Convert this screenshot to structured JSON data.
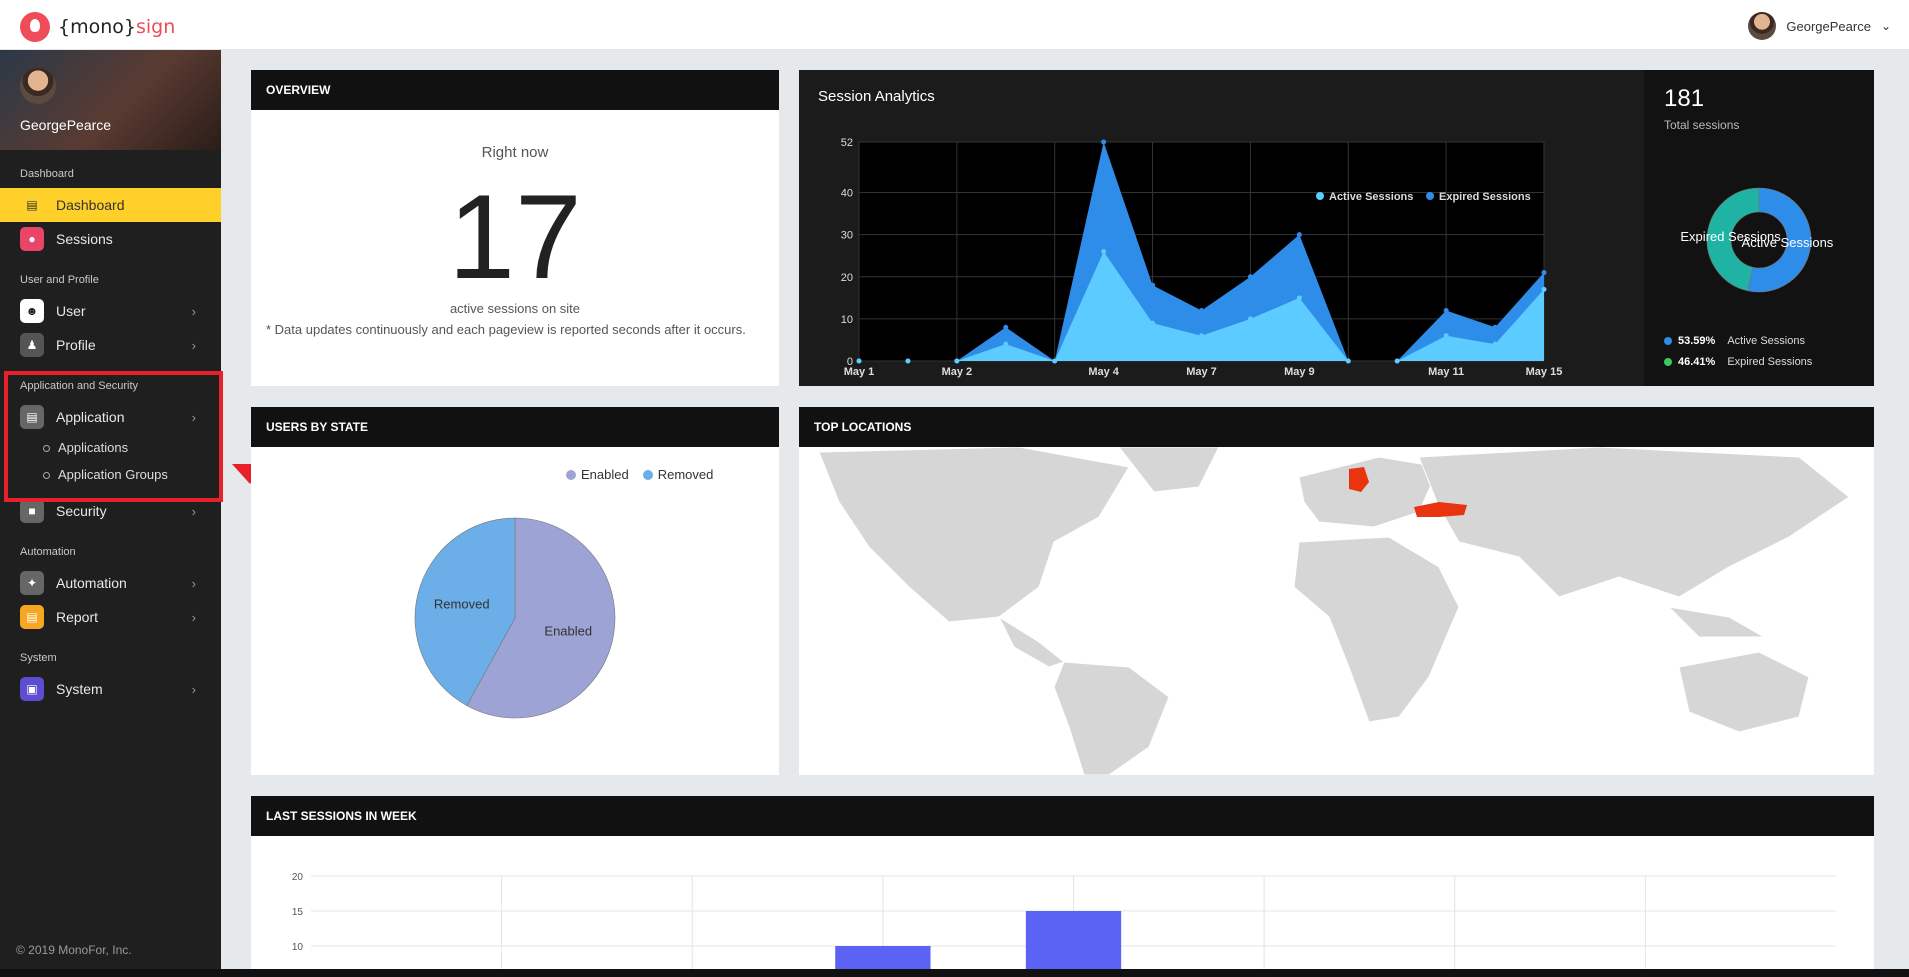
{
  "topbar": {
    "logo_prefix": "{mono}",
    "logo_brand": "sign",
    "username": "GeorgePearce"
  },
  "sidebar": {
    "username": "GeorgePearce",
    "sections": {
      "dashboard": "Dashboard",
      "user_profile": "User and Profile",
      "app_security": "Application and Security",
      "automation": "Automation",
      "system": "System"
    },
    "items": {
      "dashboard": "Dashboard",
      "sessions": "Sessions",
      "user": "User",
      "profile": "Profile",
      "application": "Application",
      "applications": "Applications",
      "application_groups": "Application Groups",
      "security": "Security",
      "automation": "Automation",
      "report": "Report",
      "system": "System"
    },
    "footer": "© 2019 MonoFor, Inc."
  },
  "overview": {
    "title": "OVERVIEW",
    "right_now": "Right now",
    "count": "17",
    "subtitle": "active sessions on site",
    "note": "* Data updates continuously and each pageview is reported seconds after it occurs."
  },
  "analytics": {
    "title": "Session Analytics",
    "total": "181",
    "total_label": "Total sessions",
    "active_pct": "53.59%",
    "active_label": "Active Sessions",
    "expired_pct": "46.41%",
    "expired_label": "Expired Sessions",
    "colors": {
      "active": "#2e8de8",
      "expired": "#1fb3a4",
      "active_area": "#5ccbff"
    }
  },
  "users_by_state": {
    "title": "USERS BY STATE",
    "legend_enabled": "Enabled",
    "legend_removed": "Removed",
    "label_enabled": "Enabled",
    "label_removed": "Removed",
    "colors": {
      "enabled": "#9ea3d6",
      "removed": "#6caee8"
    }
  },
  "top_locations": {
    "title": "TOP LOCATIONS",
    "highlighted": [
      "Germany",
      "Turkey"
    ]
  },
  "last_sessions": {
    "title": "LAST SESSIONS IN WEEK"
  },
  "chart_data": [
    {
      "type": "area",
      "title": "Session Analytics",
      "x": [
        "May 1",
        "",
        "May 2",
        "",
        "May 4",
        "",
        "May 7",
        "",
        "May 9",
        "",
        "May 11",
        "",
        "May 15"
      ],
      "tick_labels": [
        "May 1",
        "May 2",
        "May 4",
        "May 7",
        "May 9",
        "May 11",
        "May 15"
      ],
      "yticks": [
        0,
        10,
        20,
        30,
        40,
        52
      ],
      "ylim": [
        0,
        52
      ],
      "legend": [
        "Active Sessions",
        "Expired Sessions"
      ],
      "series": [
        {
          "name": "Expired Sessions",
          "values": [
            0,
            0,
            0,
            8,
            0,
            52,
            18,
            12,
            20,
            30,
            0,
            0,
            12,
            8,
            21
          ]
        },
        {
          "name": "Active Sessions",
          "values": [
            0,
            0,
            0,
            4,
            0,
            26,
            9,
            6,
            10,
            15,
            0,
            0,
            6,
            4,
            17
          ]
        }
      ],
      "x_points": 15
    },
    {
      "type": "pie",
      "labels": [
        "Active Sessions",
        "Expired Sessions"
      ],
      "values": [
        53.59,
        46.41
      ]
    },
    {
      "type": "pie",
      "labels": [
        "Enabled",
        "Removed"
      ],
      "values": [
        58,
        42
      ]
    },
    {
      "type": "bar",
      "title": "LAST SESSIONS IN WEEK",
      "yticks": [
        10,
        15,
        20
      ],
      "values": [
        0,
        0,
        0,
        10,
        15,
        0,
        0,
        0
      ]
    }
  ]
}
